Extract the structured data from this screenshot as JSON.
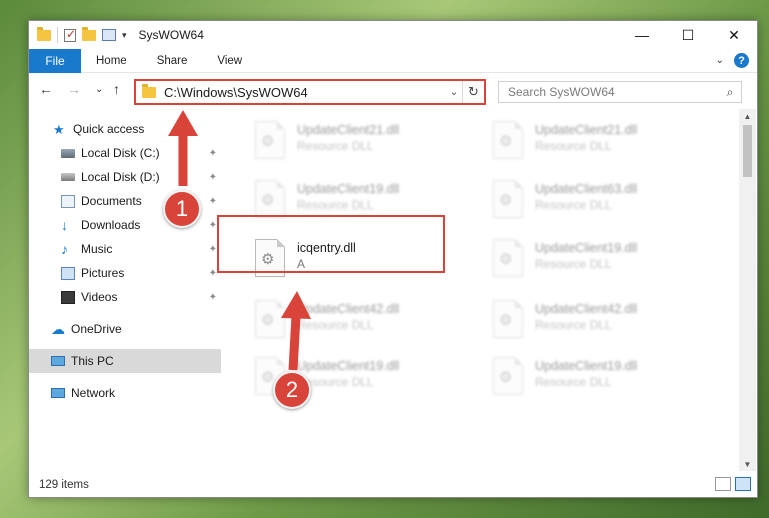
{
  "window": {
    "title": "SysWOW64",
    "minimize_glyph": "—",
    "maximize_glyph": "☐",
    "close_glyph": "✕"
  },
  "ribbon": {
    "tabs": [
      "File",
      "Home",
      "Share",
      "View"
    ],
    "help_glyph": "?",
    "collapse_glyph": "⌄"
  },
  "address": {
    "path": "C:\\Windows\\SysWOW64",
    "back_glyph": "←",
    "forward_glyph": "→",
    "recent_glyph": "⌄",
    "up_glyph": "↑",
    "dropdown_glyph": "⌄",
    "refresh_glyph": "↻"
  },
  "search": {
    "placeholder": "Search SysWOW64",
    "icon": "search-icon"
  },
  "nav": {
    "items": [
      {
        "label": "Quick access",
        "icon": "star-icon",
        "pinned": false
      },
      {
        "label": "Local Disk (C:)",
        "icon": "drive-icon",
        "pinned": true
      },
      {
        "label": "Local Disk (D:)",
        "icon": "drive-icon",
        "pinned": true
      },
      {
        "label": "Documents",
        "icon": "documents-icon",
        "pinned": true
      },
      {
        "label": "Downloads",
        "icon": "download-icon",
        "pinned": true
      },
      {
        "label": "Music",
        "icon": "music-icon",
        "pinned": true
      },
      {
        "label": "Pictures",
        "icon": "pictures-icon",
        "pinned": true
      },
      {
        "label": "Videos",
        "icon": "videos-icon",
        "pinned": true
      },
      {
        "label": "OneDrive",
        "icon": "cloud-icon",
        "pinned": false
      },
      {
        "label": "This PC",
        "icon": "computer-icon",
        "pinned": false,
        "selected": true
      },
      {
        "label": "Network",
        "icon": "network-icon",
        "pinned": false
      }
    ],
    "pin_glyph": "📌"
  },
  "files": [
    {
      "name": "UpdateClient21.dll",
      "type": "Resource DLL",
      "blurred": true
    },
    {
      "name": "UpdateClient21.dll",
      "type": "Resource DLL",
      "blurred": true
    },
    {
      "name": "UpdateClient19.dll",
      "type": "Resource DLL",
      "blurred": true
    },
    {
      "name": "UpdateClient63.dll",
      "type": "Resource DLL",
      "blurred": true
    },
    {
      "name": "icqentry.dll",
      "type": "A",
      "blurred": false
    },
    {
      "name": "UpdateClient19.dll",
      "type": "Resource DLL",
      "blurred": true
    },
    {
      "name": "UpdateClient42.dll",
      "type": "Resource DLL",
      "blurred": true
    },
    {
      "name": "UpdateClient42.dll",
      "type": "Resource DLL",
      "blurred": true
    },
    {
      "name": "UpdateClient19.dll",
      "type": "Resource DLL",
      "blurred": true
    },
    {
      "name": "UpdateClient19.dll",
      "type": "Resource DLL",
      "blurred": true
    }
  ],
  "status": {
    "item_count": "129 items"
  },
  "annotations": {
    "callout_1": "1",
    "callout_2": "2",
    "accent_color": "#d9443a"
  }
}
